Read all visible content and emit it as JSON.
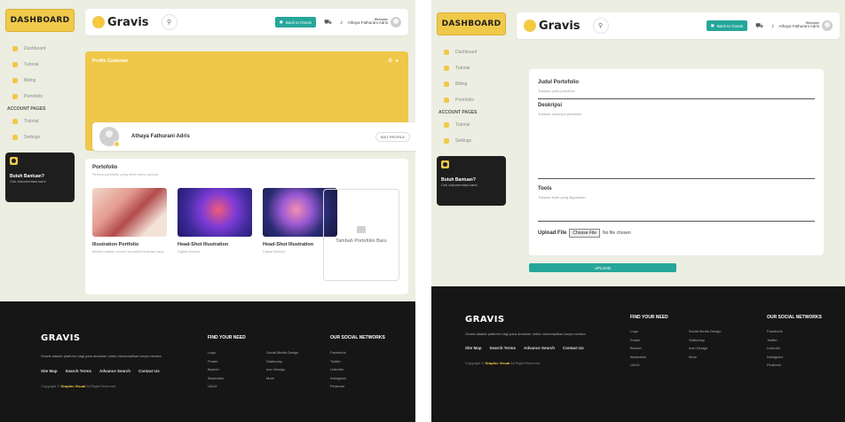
{
  "sidebar": {
    "logo": "DASHBOARD",
    "items": [
      "Dashboard",
      "Tutorial",
      "Billing",
      "Portofolio"
    ],
    "section_label": "ACCOUNT PAGES",
    "account_items": [
      "Tutorial",
      "Settings"
    ],
    "promo_title": "Butuh Bantuan?",
    "promo_text": "Cek dokumentasi kami"
  },
  "topbar": {
    "brand": "Gravis",
    "back_button": "Back to Gravis",
    "user_small": "Welcome",
    "user_name": "Athaya Fathurani Adris"
  },
  "profile": {
    "banner_label": "Profile Customer",
    "name": "Athaya Fathurani Adris",
    "edit_label": "EDIT PROFILE"
  },
  "portfolio": {
    "title": "Portofolio",
    "subtitle": "Semua portofolio yang telah kamu upload",
    "items": [
      {
        "title": "Illustration Portfolio",
        "desc": "Berikut adalah contoh portofolio ilustrasi saya"
      },
      {
        "title": "Head-Shot Illustration",
        "desc": "Digital Artwork"
      },
      {
        "title": "Head-Shot Illustration",
        "desc": "Digital Artwork"
      }
    ],
    "add_label": "Tambah Portofolio Baru"
  },
  "form": {
    "title_label": "Judul Portofolio",
    "title_placeholder": "Tuliskan judul portofolio",
    "desc_label": "Deskripsi",
    "desc_placeholder": "Tuliskan deskripsi portofolio",
    "tools_label": "Tools",
    "tools_placeholder": "Tuliskan tools yang digunakan",
    "upload_label": "Upload File",
    "choose_label": "Choose File",
    "no_file": "No file chosen",
    "upload_button": "UPLOAD"
  },
  "footer": {
    "brand": "GRAVIS",
    "desc": "Gravis adalah platform bagi para desainer untuk menampilkan karya mereka",
    "links": [
      "Site Map",
      "Search Terms",
      "Advance Search",
      "Contact Us"
    ],
    "copyright_prefix": "Copyright ©",
    "copyright_brand": "Graphic Visual",
    "copyright_suffix": "All Right Reserved",
    "col1_head": "FIND YOUR NEED",
    "col1": [
      "Logo",
      "Poster",
      "Banner",
      "Illustration",
      "UI/UX"
    ],
    "col2": [
      "Social Media Design",
      "Stationary",
      "Icon Design",
      "More"
    ],
    "col3_head": "OUR SOCIAL NETWORKS",
    "col3": [
      "Facebook",
      "Twitter",
      "Linkedin",
      "Instagram",
      "Pinterest"
    ]
  }
}
